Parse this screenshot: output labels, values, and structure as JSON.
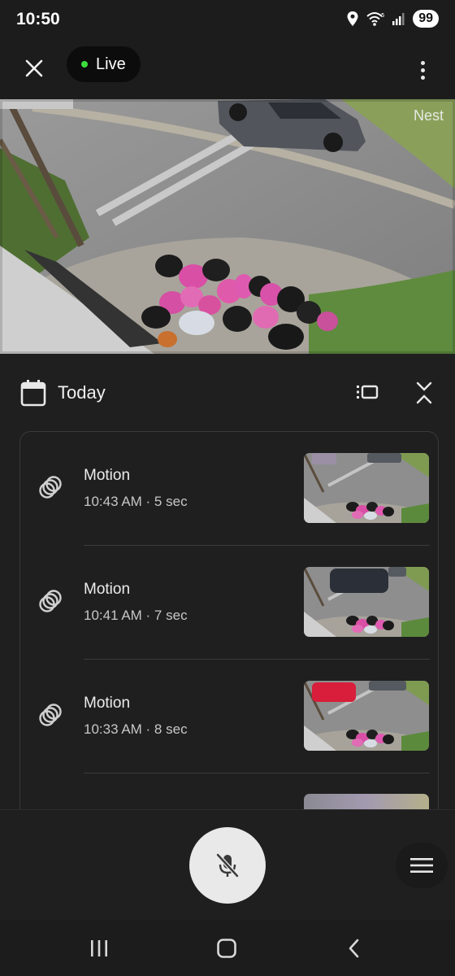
{
  "status_bar": {
    "time": "10:50",
    "battery": "99",
    "icons": [
      "location-icon",
      "wifi-icon",
      "signal-icon"
    ]
  },
  "header": {
    "live_label": "Live",
    "live_dot_color": "#3ddc3d"
  },
  "camera": {
    "watermark": "Nest"
  },
  "timeline": {
    "date_label": "Today"
  },
  "events": [
    {
      "title": "Motion",
      "time": "10:43 AM",
      "duration": "5 sec",
      "meta": "10:43 AM · 5 sec",
      "car_color": "#9a8fa4"
    },
    {
      "title": "Motion",
      "time": "10:41 AM",
      "duration": "7 sec",
      "meta": "10:41 AM · 7 sec",
      "car_color": "#2b3038"
    },
    {
      "title": "Motion",
      "time": "10:33 AM",
      "duration": "8 sec",
      "meta": "10:33 AM · 8 sec",
      "car_color": "#d81e3a"
    }
  ],
  "controls": {
    "mic_state": "muted",
    "icons": [
      "mic-off-icon",
      "menu-icon"
    ]
  },
  "nav": {
    "icons": [
      "recents-icon",
      "home-icon",
      "back-icon"
    ]
  }
}
